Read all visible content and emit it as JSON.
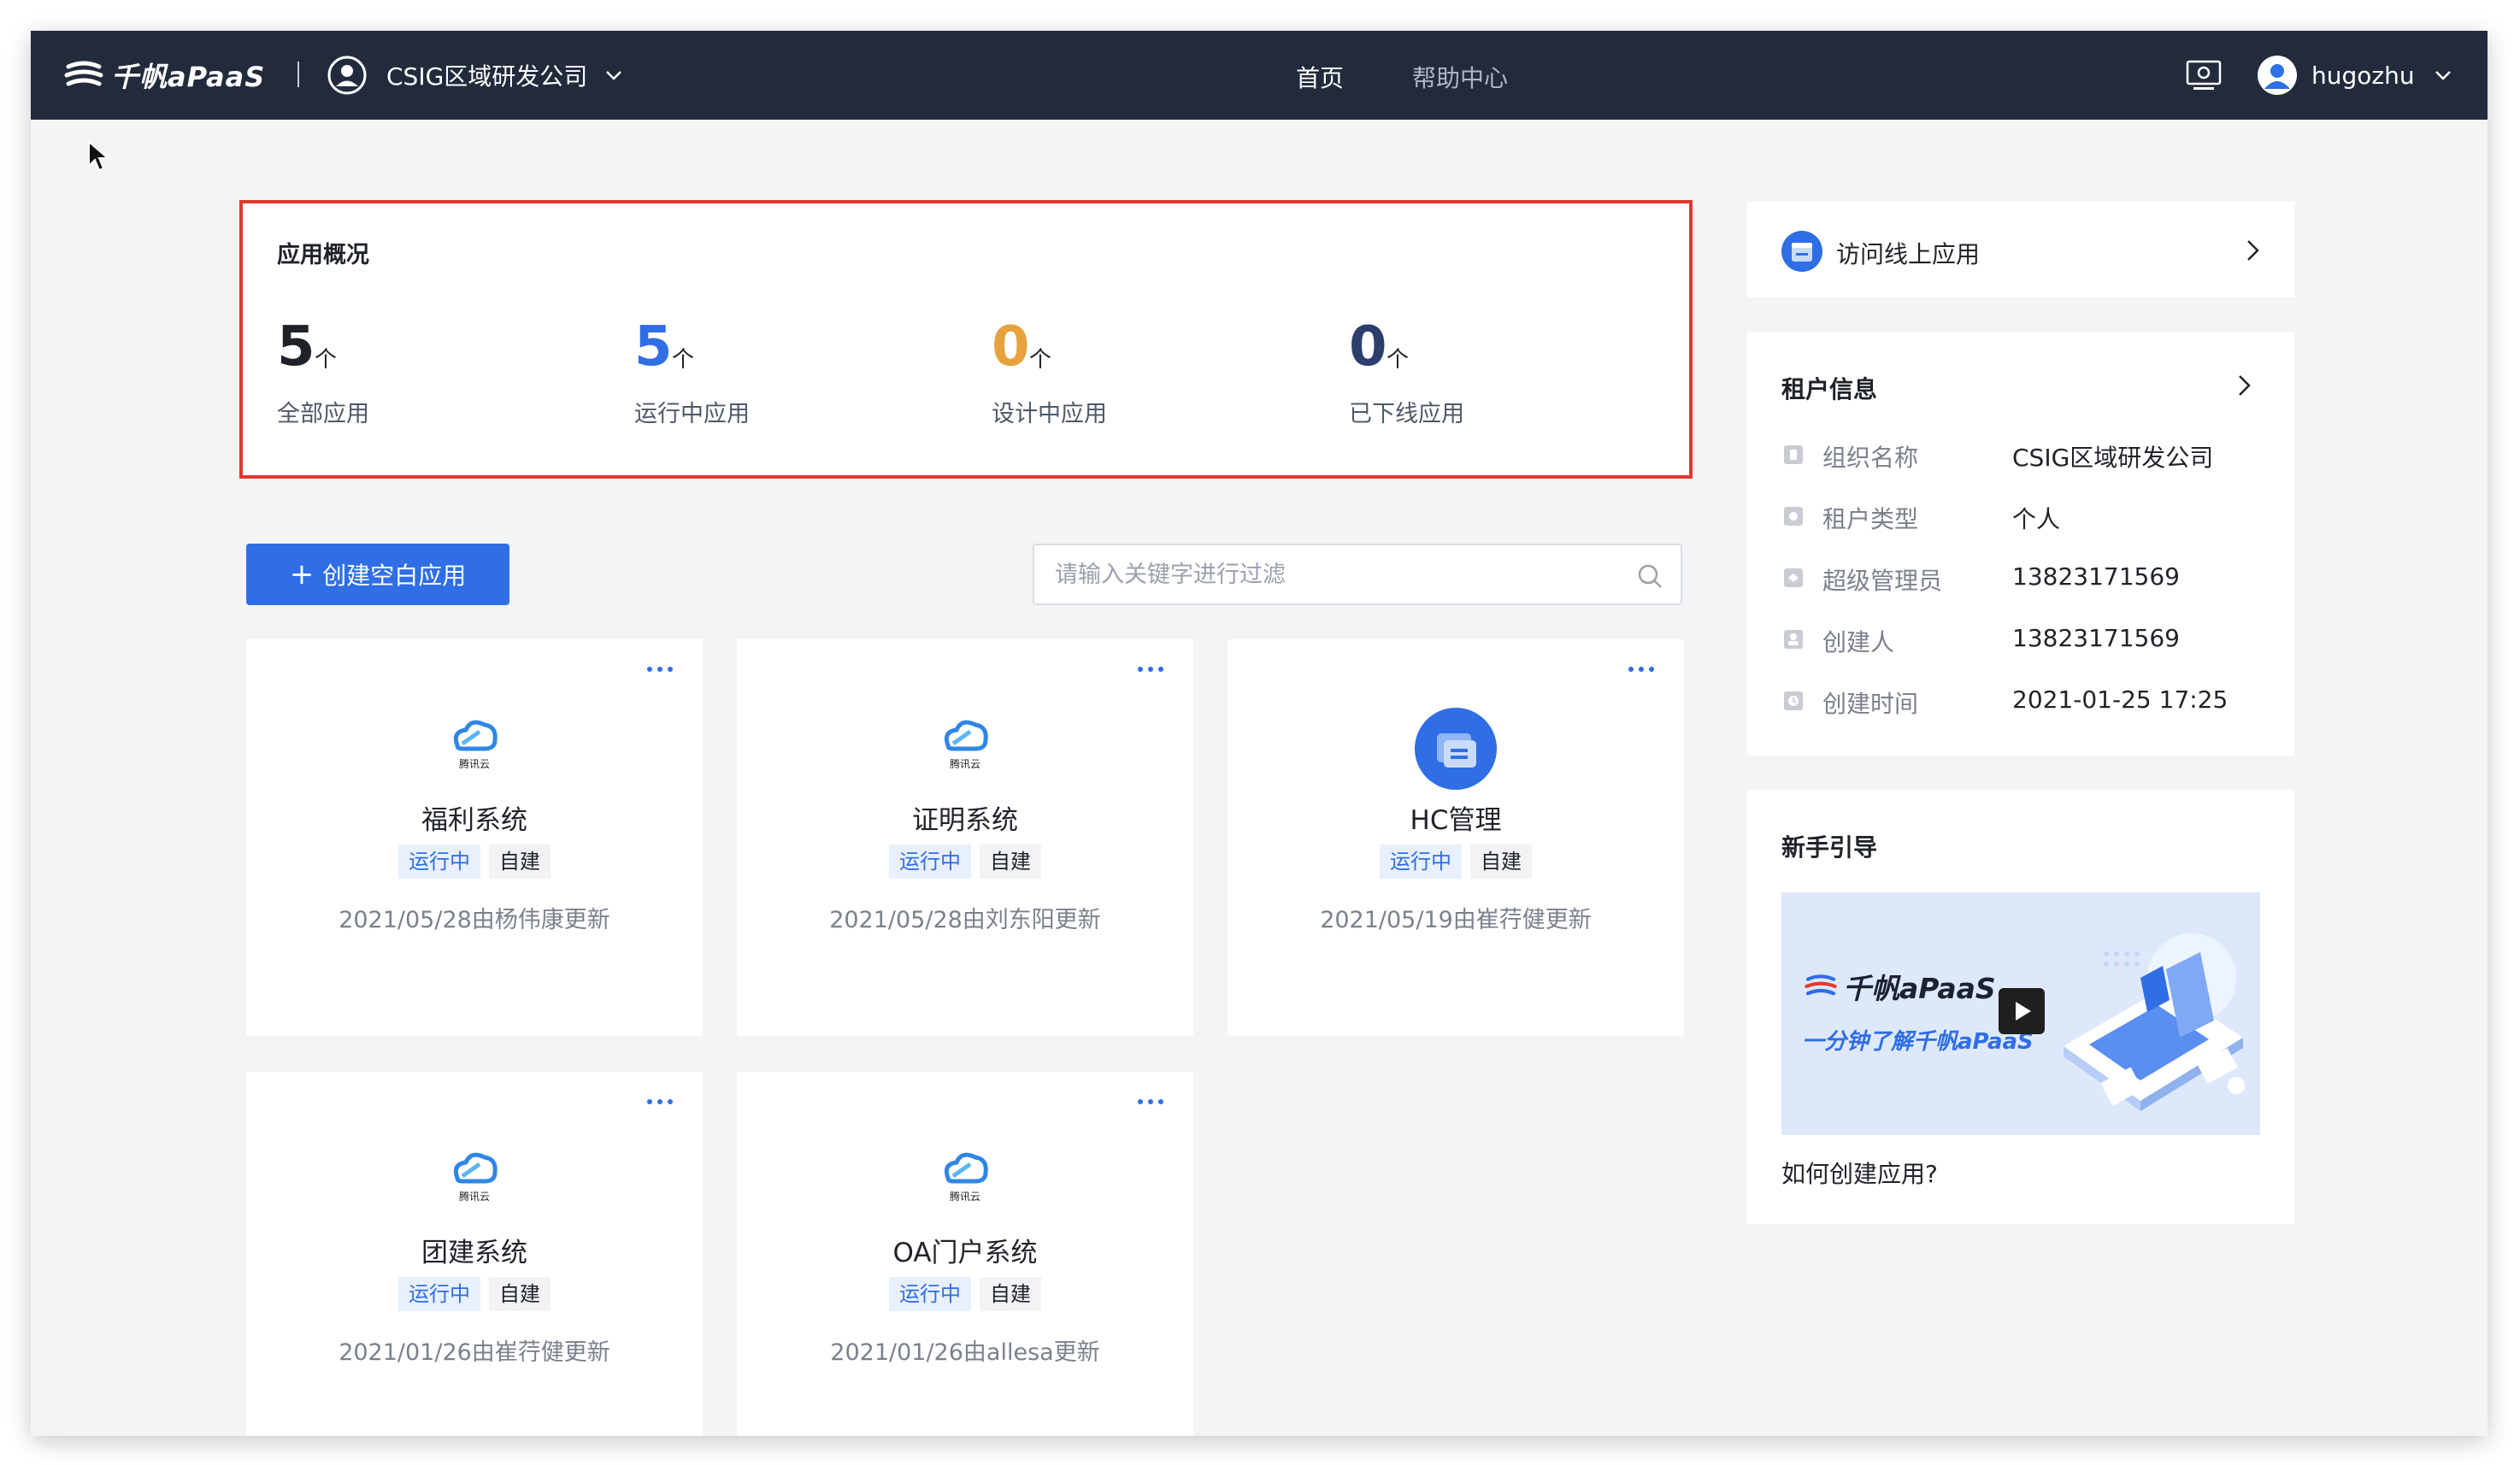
{
  "app": {
    "brand": "千帆aPaaS",
    "org_name": "CSIG区域研发公司",
    "nav": {
      "home": "首页",
      "help": "帮助中心"
    },
    "user": "hugozhu"
  },
  "overview": {
    "title": "应用概况",
    "stats": [
      {
        "value": "5",
        "unit": "个",
        "label": "全部应用",
        "color": "#1f2329"
      },
      {
        "value": "5",
        "unit": "个",
        "label": "运行中应用",
        "color": "#2f6ee5"
      },
      {
        "value": "0",
        "unit": "个",
        "label": "设计中应用",
        "color": "#e6a23c"
      },
      {
        "value": "0",
        "unit": "个",
        "label": "已下线应用",
        "color": "#2c3e6b"
      }
    ]
  },
  "toolbar": {
    "create_label": "创建空白应用",
    "search_placeholder": "请输入关键字进行过滤"
  },
  "apps": [
    {
      "name": "福利系统",
      "status": "运行中",
      "source": "自建",
      "updated": "2021/05/28由杨伟康更新",
      "icon": "tencent-cloud-icon",
      "icon_text": "腾讯云"
    },
    {
      "name": "证明系统",
      "status": "运行中",
      "source": "自建",
      "updated": "2021/05/28由刘东阳更新",
      "icon": "tencent-cloud-icon",
      "icon_text": "腾讯云"
    },
    {
      "name": "HC管理",
      "status": "运行中",
      "source": "自建",
      "updated": "2021/05/19由崔荇健更新",
      "icon": "app-folder-icon"
    },
    {
      "name": "团建系统",
      "status": "运行中",
      "source": "自建",
      "updated": "2021/01/26由崔荇健更新",
      "icon": "tencent-cloud-icon",
      "icon_text": "腾讯云"
    },
    {
      "name": "OA门户系统",
      "status": "运行中",
      "source": "自建",
      "updated": "2021/01/26由allesa更新",
      "icon": "tencent-cloud-icon",
      "icon_text": "腾讯云"
    }
  ],
  "visit_online": {
    "label": "访问线上应用"
  },
  "tenant": {
    "title": "租户信息",
    "rows": [
      {
        "key": "组织名称",
        "value": "CSIG区域研发公司"
      },
      {
        "key": "租户类型",
        "value": "个人"
      },
      {
        "key": "超级管理员",
        "value": "13823171569"
      },
      {
        "key": "创建人",
        "value": "13823171569"
      },
      {
        "key": "创建时间",
        "value": "2021-01-25 17:25"
      }
    ]
  },
  "guide": {
    "title": "新手引导",
    "banner_brand": "千帆aPaaS",
    "banner_slogan": "一分钟了解千帆aPaaS",
    "link": "如何创建应用?"
  },
  "colors": {
    "topbar": "#222b3c",
    "primary": "#2f6ee5",
    "highlight_border": "#e1392f",
    "background": "#f3f4f6"
  }
}
